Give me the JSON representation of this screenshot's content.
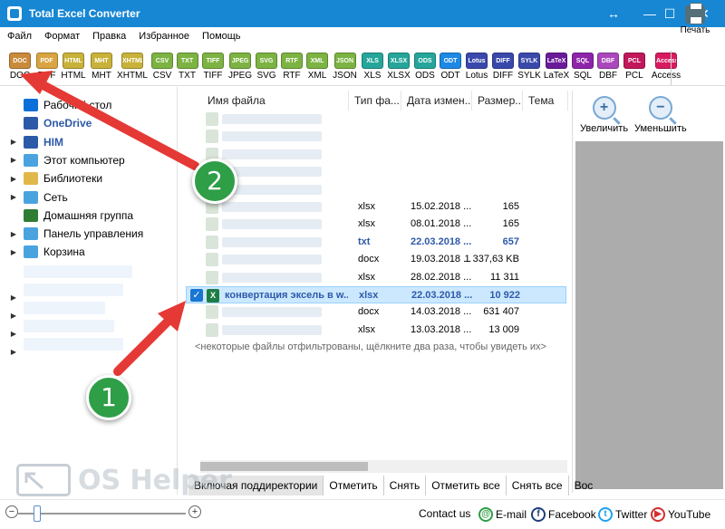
{
  "window": {
    "title": "Total Excel Converter",
    "controls": [
      "↔",
      "—",
      "☐",
      "✕"
    ]
  },
  "menu": [
    "Файл",
    "Формат",
    "Правка",
    "Избранное",
    "Помощь"
  ],
  "toolbar": {
    "formats": [
      {
        "label": "DOC",
        "color": "#c98a3a",
        "icon_text": "DOC"
      },
      {
        "label": "PDF",
        "color": "#d9a441",
        "icon_text": "PDF"
      },
      {
        "label": "HTML",
        "color": "#c8b23a",
        "icon_text": "HTML"
      },
      {
        "label": "MHT",
        "color": "#c8b23a",
        "icon_text": "MHT"
      },
      {
        "label": "XHTML",
        "color": "#c8b23a",
        "icon_text": "XHTML"
      },
      {
        "label": "CSV",
        "color": "#7cb342",
        "icon_text": "CSV"
      },
      {
        "label": "TXT",
        "color": "#7cb342",
        "icon_text": "TXT"
      },
      {
        "label": "TIFF",
        "color": "#7cb342",
        "icon_text": "TIFF"
      },
      {
        "label": "JPEG",
        "color": "#7cb342",
        "icon_text": "JPEG"
      },
      {
        "label": "SVG",
        "color": "#7cb342",
        "icon_text": "SVG"
      },
      {
        "label": "RTF",
        "color": "#7cb342",
        "icon_text": "RTF"
      },
      {
        "label": "XML",
        "color": "#7cb342",
        "icon_text": "XML"
      },
      {
        "label": "JSON",
        "color": "#7cb342",
        "icon_text": "JSON"
      },
      {
        "label": "XLS",
        "color": "#26a69a",
        "icon_text": "XLS"
      },
      {
        "label": "XLSX",
        "color": "#26a69a",
        "icon_text": "XLSX"
      },
      {
        "label": "ODS",
        "color": "#26a69a",
        "icon_text": "ODS"
      },
      {
        "label": "ODT",
        "color": "#1e88e5",
        "icon_text": "ODT"
      },
      {
        "label": "Lotus",
        "color": "#3949ab",
        "icon_text": "Lotus"
      },
      {
        "label": "DIFF",
        "color": "#3949ab",
        "icon_text": "DIFF"
      },
      {
        "label": "SYLK",
        "color": "#3949ab",
        "icon_text": "SYLK"
      },
      {
        "label": "LaTeX",
        "color": "#6a1b9a",
        "icon_text": "LaTeX"
      },
      {
        "label": "SQL",
        "color": "#8e24aa",
        "icon_text": "SQL"
      },
      {
        "label": "DBF",
        "color": "#ab47bc",
        "icon_text": "DBF"
      },
      {
        "label": "PCL",
        "color": "#c2185b",
        "icon_text": "PCL"
      },
      {
        "label": "Access",
        "color": "#d81b60",
        "icon_text": "Access"
      }
    ],
    "print_label": "Печать"
  },
  "tree": {
    "items": [
      {
        "label": "Рабочий стол",
        "icon": "desktop-icon",
        "expandable": false,
        "bold": false,
        "color": "#0a6fd8"
      },
      {
        "label": "OneDrive",
        "icon": "cloud-icon",
        "expandable": false,
        "bold": true,
        "color": "#2d5aa8"
      },
      {
        "label": "HIM",
        "icon": "user-icon",
        "expandable": true,
        "bold": true,
        "color": "#2d5aa8"
      },
      {
        "label": "Этот компьютер",
        "icon": "computer-icon",
        "expandable": true,
        "bold": false,
        "color": "#4aa3df"
      },
      {
        "label": "Библиотеки",
        "icon": "library-icon",
        "expandable": true,
        "bold": false,
        "color": "#e0b84a"
      },
      {
        "label": "Сеть",
        "icon": "network-icon",
        "expandable": true,
        "bold": false,
        "color": "#4aa3df"
      },
      {
        "label": "Домашняя группа",
        "icon": "homegroup-icon",
        "expandable": false,
        "bold": false,
        "color": "#2e7d32"
      },
      {
        "label": "Панель управления",
        "icon": "control-panel-icon",
        "expandable": true,
        "bold": false,
        "color": "#4aa3df"
      },
      {
        "label": "Корзина",
        "icon": "recycle-bin-icon",
        "expandable": true,
        "bold": false,
        "color": "#4aa3df"
      }
    ]
  },
  "filelist": {
    "columns": [
      "Имя файла",
      "Тип фа...",
      "Дата измен...",
      "Размер...",
      "Тема"
    ],
    "rows": [
      {
        "type": "",
        "date": "",
        "size": "",
        "bold": false
      },
      {
        "type": "",
        "date": "",
        "size": "",
        "bold": false
      },
      {
        "type": "",
        "date": "",
        "size": "",
        "bold": false
      },
      {
        "type": "",
        "date": "",
        "size": "",
        "bold": false
      },
      {
        "type": "",
        "date": "",
        "size": "",
        "bold": false
      },
      {
        "type": "xlsx",
        "date": "15.02.2018 ...",
        "size": "165",
        "bold": false
      },
      {
        "type": "xlsx",
        "date": "08.01.2018 ...",
        "size": "165",
        "bold": false
      },
      {
        "type": "txt",
        "date": "22.03.2018 ...",
        "size": "657",
        "bold": true
      },
      {
        "type": "docx",
        "date": "19.03.2018 ...",
        "size": "1 337,63 KB",
        "bold": false
      },
      {
        "type": "xlsx",
        "date": "28.02.2018 ...",
        "size": "11 311",
        "bold": false
      },
      {
        "type": "xlsx",
        "date": "22.03.2018 ...",
        "size": "10 922",
        "bold": true,
        "selected": true,
        "name": "конвертация эксель в w..."
      },
      {
        "type": "docx",
        "date": "14.03.2018 ...",
        "size": "631 407",
        "bold": false
      },
      {
        "type": "xlsx",
        "date": "13.03.2018 ...",
        "size": "13 009",
        "bold": false
      }
    ],
    "filter_note": "<некоторые файлы отфильтрованы, щёлкните два раза, чтобы увидеть их>"
  },
  "preview": {
    "zoom_in_label": "Увеличить",
    "zoom_out_label": "Уменьшить"
  },
  "bottom_buttons": [
    "Включая поддиректории",
    "Отметить",
    "Снять",
    "Отметить все",
    "Снять все",
    "Вос"
  ],
  "status": {
    "contact": "Contact us",
    "email": "E-mail",
    "facebook": "Facebook",
    "twitter": "Twitter",
    "youtube": "YouTube"
  },
  "watermark": {
    "text": "OS Helper"
  },
  "annotations": {
    "marker_1": "1",
    "marker_2": "2",
    "arrow_color": "#e53935",
    "marker_color": "#2e9e47"
  }
}
